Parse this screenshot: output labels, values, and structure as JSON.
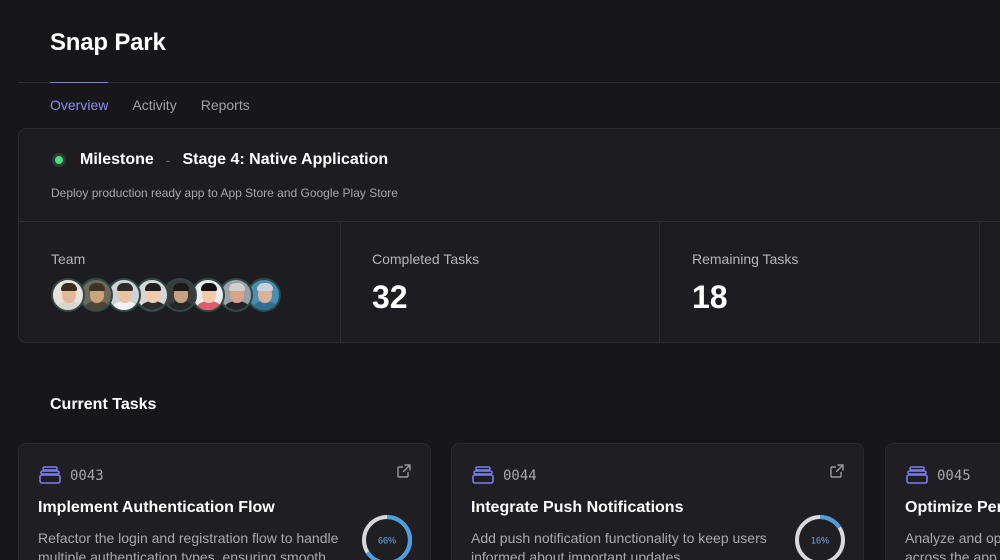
{
  "app": {
    "title": "Snap Park"
  },
  "tabs": [
    {
      "label": "Overview",
      "active": true
    },
    {
      "label": "Activity",
      "active": false
    },
    {
      "label": "Reports",
      "active": false
    }
  ],
  "milestone": {
    "label": "Milestone",
    "separator": "-",
    "stage": "Stage 4: Native Application",
    "description": "Deploy production ready app to App Store and Google Play Store",
    "status_color": "#4ade80"
  },
  "stats": {
    "team_label": "Team",
    "team_avatar_count": 8,
    "completed_label": "Completed Tasks",
    "completed_value": "32",
    "remaining_label": "Remaining Tasks",
    "remaining_value": "18"
  },
  "current_tasks": {
    "title": "Current Tasks",
    "tasks": [
      {
        "id": "0043",
        "title": "Implement Authentication Flow",
        "description": "Refactor the login and registration flow to handle multiple authentication types, ensuring smooth",
        "progress_label": "66%",
        "progress": 0.66
      },
      {
        "id": "0044",
        "title": "Integrate Push Notifications",
        "description": "Add push notification functionality to keep users informed about important updates",
        "progress_label": "16%",
        "progress": 0.16
      },
      {
        "id": "0045",
        "title": "Optimize Per",
        "description": "Analyze and op across the app"
      }
    ]
  },
  "colors": {
    "accent": "#7b7ef0",
    "progress": "#4a9fe0",
    "progress_track": "#d8d8dc",
    "task_icon": "#7b7ef0"
  }
}
